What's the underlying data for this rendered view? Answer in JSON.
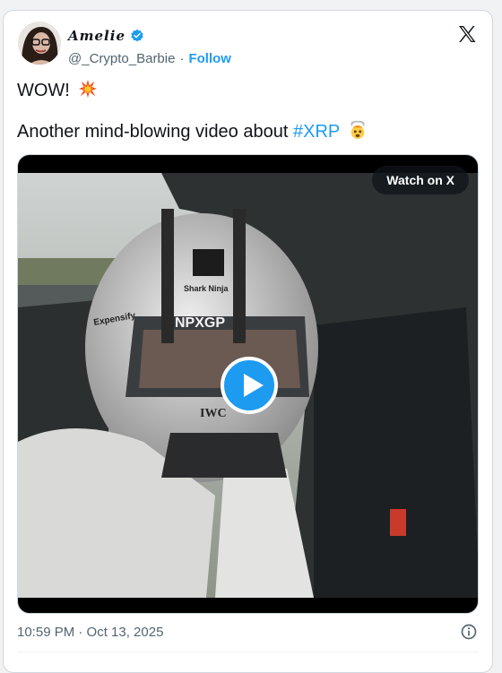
{
  "author": {
    "display_name": "Amelie",
    "handle": "@_Crypto_Barbie",
    "separator": "·",
    "follow_label": "Follow"
  },
  "tweet": {
    "line1": "WOW!",
    "line2_prefix": "Another mind-blowing video about",
    "hashtag": "#XRP"
  },
  "media": {
    "watch_label": "Watch on X",
    "helmet_texts": [
      "Shark Ninja",
      "Expensify",
      "NPXGP",
      "IWC"
    ]
  },
  "footer": {
    "timestamp": "10:59 PM · Oct 13, 2025"
  },
  "icons": {
    "x_logo": "x-logo-icon",
    "verified": "verified-badge-icon",
    "collision": "collision-emoji",
    "exploding_head": "exploding-head-emoji",
    "play": "play-icon",
    "info": "info-icon"
  },
  "colors": {
    "accent": "#1d9bf0",
    "text": "#0f1419",
    "secondary": "#536471"
  }
}
